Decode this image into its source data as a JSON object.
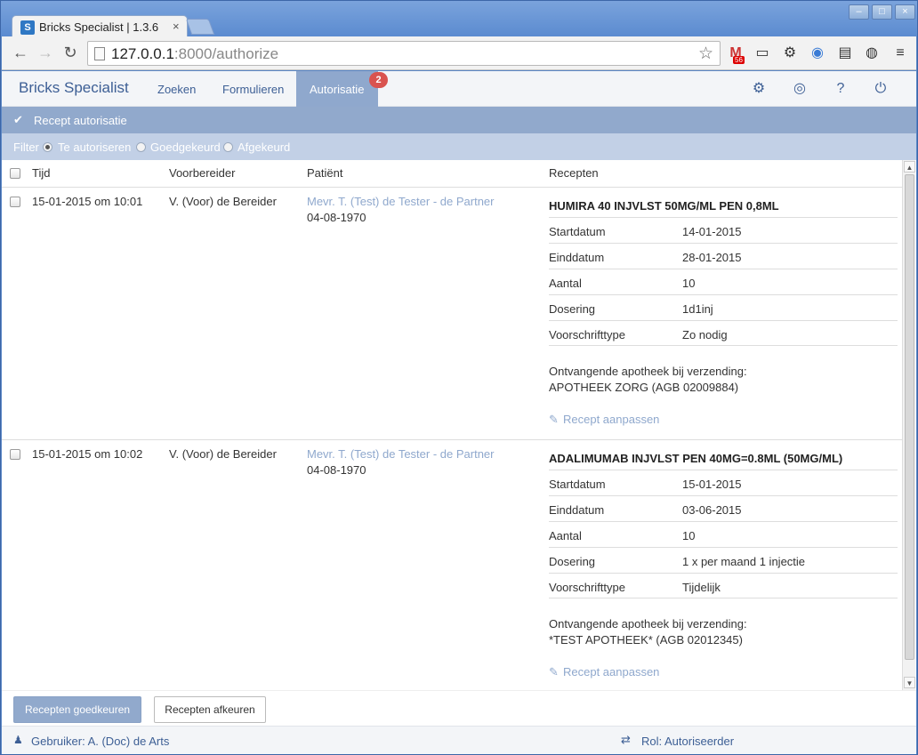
{
  "browser": {
    "tab_title": "Bricks Specialist | 1.3.6",
    "tab_favicon": "S",
    "url_host": "127.0.0.1",
    "url_rest": ":8000/authorize",
    "mail_badge": "56",
    "icons": [
      "back-icon",
      "forward-icon",
      "reload-icon",
      "star-icon",
      "gmail-icon",
      "cast-icon",
      "gear-icon",
      "disc-icon",
      "card-icon",
      "color-wheel-icon",
      "menu-icon"
    ]
  },
  "navbar": {
    "brand": "Bricks Specialist",
    "links": [
      "Zoeken",
      "Formulieren"
    ],
    "active": "Autorisatie",
    "badge": "2"
  },
  "panel": {
    "title": "Recept autorisatie"
  },
  "filter": {
    "label": "Filter",
    "options": [
      "Te autoriseren",
      "Goedgekeurd",
      "Afgekeurd"
    ],
    "selected": "Te autoriseren"
  },
  "table": {
    "headers": [
      "Tijd",
      "Voorbereider",
      "Patiënt",
      "Recepten"
    ],
    "field_labels": [
      "Startdatum",
      "Einddatum",
      "Aantal",
      "Dosering",
      "Voorschrifttype"
    ],
    "pharmacy_label": "Ontvangende apotheek bij verzending:",
    "edit_label": "Recept aanpassen",
    "rows": [
      {
        "tijd": "15-01-2015 om 10:01",
        "voorbereider": "V. (Voor) de Bereider",
        "patient": "Mevr. T. (Test) de Tester - de Partner",
        "geboortedatum": "04-08-1970",
        "recept": "HUMIRA 40 INJVLST 50MG/ML PEN 0,8ML",
        "values": [
          "14-01-2015",
          "28-01-2015",
          "10",
          "1d1inj",
          "Zo nodig"
        ],
        "apotheek": "APOTHEEK ZORG (AGB 02009884)"
      },
      {
        "tijd": "15-01-2015 om 10:02",
        "voorbereider": "V. (Voor) de Bereider",
        "patient": "Mevr. T. (Test) de Tester - de Partner",
        "geboortedatum": "04-08-1970",
        "recept": "ADALIMUMAB INJVLST PEN 40MG=0.8ML (50MG/ML)",
        "values": [
          "15-01-2015",
          "03-06-2015",
          "10",
          "1 x per maand 1 injectie",
          "Tijdelijk"
        ],
        "apotheek": "*TEST APOTHEEK* (AGB 02012345)"
      }
    ]
  },
  "actions": {
    "approve": "Recepten goedkeuren",
    "reject": "Recepten afkeuren"
  },
  "footer": {
    "user": "Gebruiker: A. (Doc) de Arts",
    "role": "Rol: Autoriseerder"
  }
}
